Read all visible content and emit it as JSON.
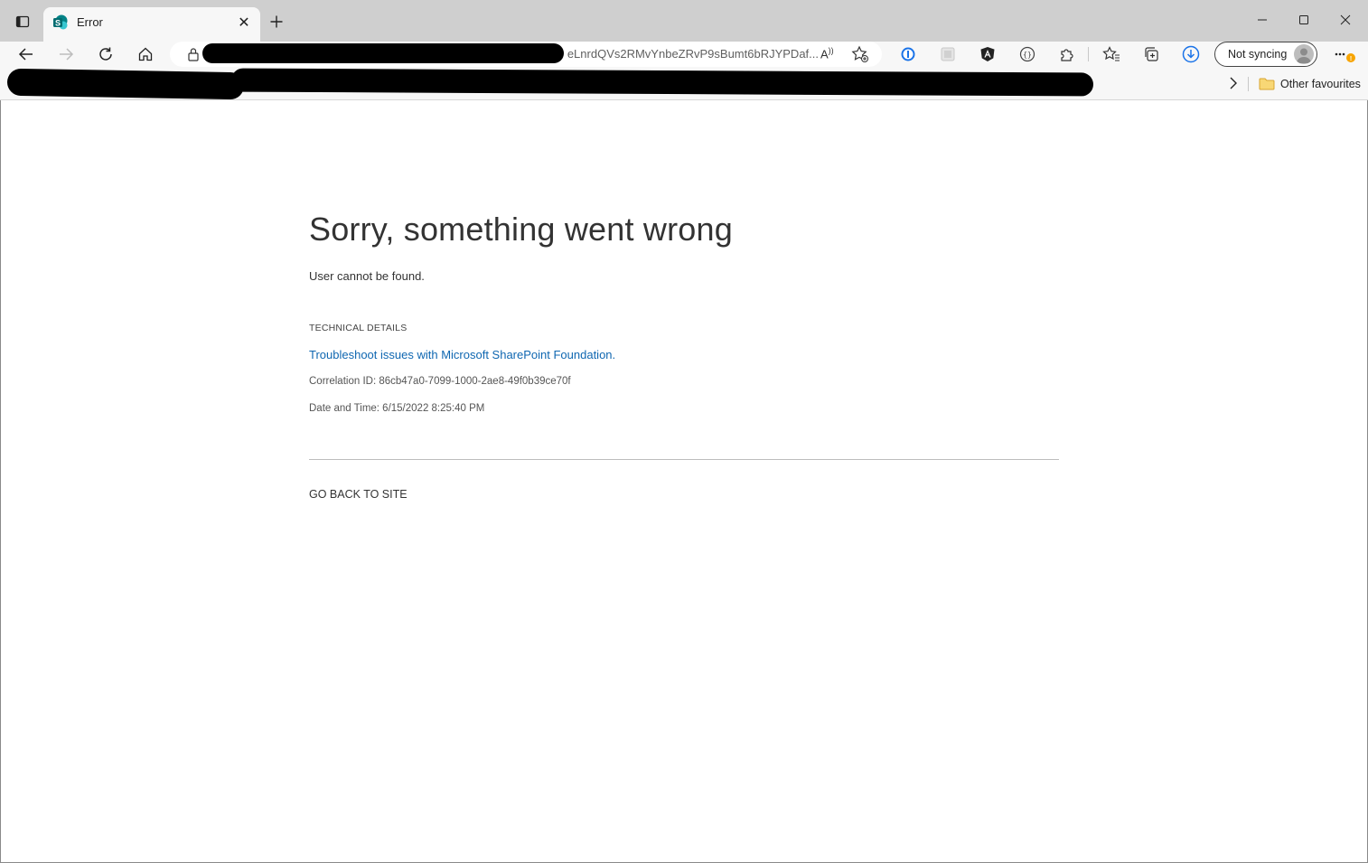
{
  "browser": {
    "tab": {
      "title": "Error",
      "favicon": "sharepoint-icon",
      "close_glyph": "✕"
    },
    "address_bar": {
      "url_visible_tail": "eLnrdQVs2RMvYnbeZRvP9sBumt6bRJYPDaf..."
    },
    "profile": {
      "sync_label": "Not syncing"
    },
    "favourites_bar": {
      "other_favourites_label": "Other favourites"
    }
  },
  "page": {
    "title": "Sorry, something went wrong",
    "message": "User cannot be found.",
    "technical_details_heading": "TECHNICAL DETAILS",
    "troubleshoot_link": "Troubleshoot issues with Microsoft SharePoint Foundation.",
    "correlation_id": "Correlation ID: 86cb47a0-7099-1000-2ae8-49f0b39ce70f",
    "date_time": "Date and Time: 6/15/2022 8:25:40 PM",
    "go_back_label": "GO BACK TO SITE"
  },
  "colors": {
    "link": "#0f67b1",
    "tabstrip_bg": "#cfcfcf",
    "toolbar_bg": "#f7f7f7",
    "sharepoint_teal": "#038387"
  }
}
